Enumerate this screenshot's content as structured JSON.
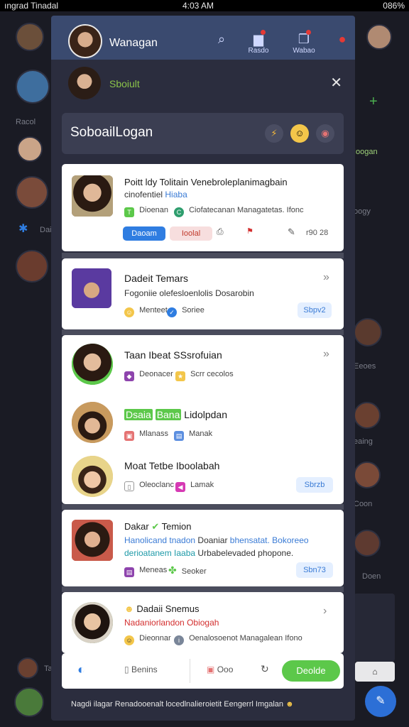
{
  "status_bar": {
    "left": "ıngrad Tinadal",
    "center": "4:03 AM",
    "right": "086%"
  },
  "background": {
    "left_labels": [
      "Racol",
      "Dai"
    ],
    "right_labels": [
      "Ioogan",
      "oogy",
      "Eeoes",
      "eaing",
      "Coon",
      "Doen"
    ],
    "bottom_label": "Ta"
  },
  "header": {
    "user_name": "Wanagan",
    "icon_labels": [
      "Search",
      "Rasdo",
      "Wabao"
    ]
  },
  "profile": {
    "status": "Sboiult"
  },
  "search_bar": {
    "title": "SoboailLogan"
  },
  "cards": [
    {
      "title": "Poitt ldy Tolitain Venebroleplanimagbain",
      "subtitle": "cinofentiel",
      "subtitle_highlight": "Hiaba",
      "chip1": "Dioenan",
      "chip2": "Ciofatecanan Managatetas. Ifonc",
      "btn_primary": "Daoam",
      "btn_secondary": "Ioolal",
      "meta": "r90 28"
    },
    {
      "title": "Dadeit Temars",
      "subtitle": "Fogoniie olefesloenlolis Dosarobin",
      "chip1": "Menteet",
      "chip2": "Soriee",
      "pill": "Sbpv2"
    },
    {
      "title": "Taan Ibeat SSsrofuian",
      "chip1": "Deonacer",
      "chip2": "Scrr cecolos"
    },
    {
      "title_badge1": "Dsaia",
      "title_badge2": "Bana",
      "title": "Lidolpdan",
      "chip1": "Mlanass",
      "chip2": "Manak"
    },
    {
      "title": "Moat Tetbe Iboolabah",
      "chip1": "Oleoclanc",
      "chip2": "Lamak",
      "pill": "Sbrzb"
    },
    {
      "title_prefix": "Dakar",
      "title": "Temion",
      "line1a": "Hanolicand tnadon",
      "line1b": "Doaniar",
      "line1c": "bhensatat. Bokoreeo",
      "line2a": "derioatanem Iaaba",
      "line2b": "Urbabelevaded phopone.",
      "chip1": "Meneas",
      "chip2": "Seoker",
      "pill": "Sbn73"
    },
    {
      "title": "Dadaii Snemus",
      "subtitle": "Nadaniorlandon Obiogah",
      "chip1": "Dieonnar",
      "chip2": "Oenalosoenot Managalean Ifono"
    }
  ],
  "bottom_bar": {
    "item1": "Benins",
    "item2": "Ooo",
    "send": "Deolde"
  },
  "footer": {
    "text": "Nagdi ilagar Renadooenalt locedlnalieroietit Eengerrl Imgalan"
  },
  "colors": {
    "accent": "#2f7de1",
    "positive": "#5cc84a",
    "topbar": "#3a4a6f",
    "panel": "#2b2d3e"
  }
}
